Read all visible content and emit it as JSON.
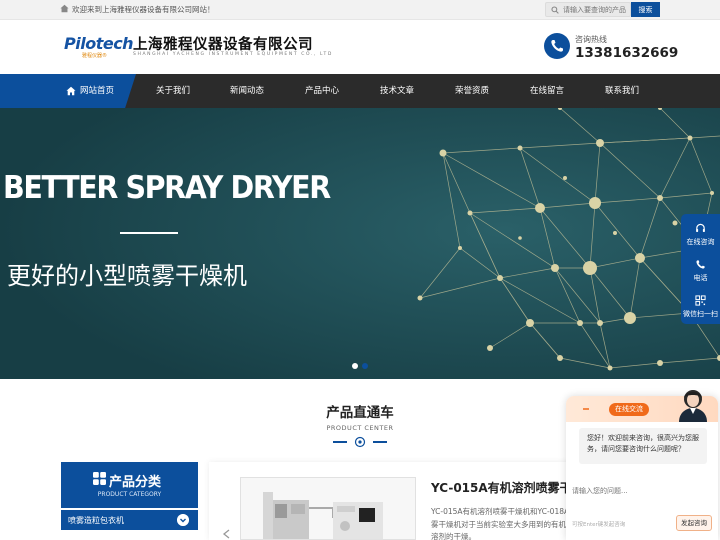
{
  "topbar": {
    "welcome": "欢迎来到上海雅程仪器设备有限公司网站！",
    "search_placeholder": "请输入要查询的产品",
    "search_button": "搜索"
  },
  "header": {
    "logo_text": "Pilotech",
    "logo_sub": "雅程仪器®",
    "company_name": "上海雅程仪器设备有限公司",
    "company_name_en": "SHANGHAI YACHENG INSTRUMENT EQUIPMENT CO., LTD",
    "hotline_label": "咨询热线",
    "hotline_number": "13381632669"
  },
  "nav": {
    "items": [
      "网站首页",
      "关于我们",
      "新闻动态",
      "产品中心",
      "技术文章",
      "荣誉资质",
      "在线留言",
      "联系我们"
    ],
    "active_index": 0
  },
  "banner": {
    "title": "BETTER SPRAY DRYER",
    "subtitle": "更好的小型喷雾干燥机",
    "slide_count": 2,
    "active_slide": 0
  },
  "side_tools": {
    "items": [
      "在线咨询",
      "电话",
      "微信扫一扫"
    ]
  },
  "products": {
    "title": "产品直通车",
    "subtitle": "PRODUCT CENTER",
    "category_title": "产品分类",
    "category_subtitle": "PRODUCT CATEGORY",
    "categories": [
      "喷雾造粒包衣机"
    ],
    "featured_title": "YC-015A有机溶剂喷雾干",
    "featured_desc": "YC-015A有机溶剂喷雾干燥机和YC-018A雾干燥机对于当前实验室大多用到的有机溶剂的干燥。"
  },
  "chat": {
    "header_label": "在线交流",
    "greeting": "您好！欢迎前来咨询，很高兴为您服务，请问您要咨询什么问题呢？",
    "input_placeholder": "请输入您的问题...",
    "hint": "可按Enter键发起咨询",
    "send_button": "发起咨询"
  },
  "colors": {
    "brand_blue": "#0c4f9c",
    "nav_dark": "#2b2b2b",
    "banner_teal": "#1f4e57",
    "chat_orange": "#f06a1a"
  }
}
